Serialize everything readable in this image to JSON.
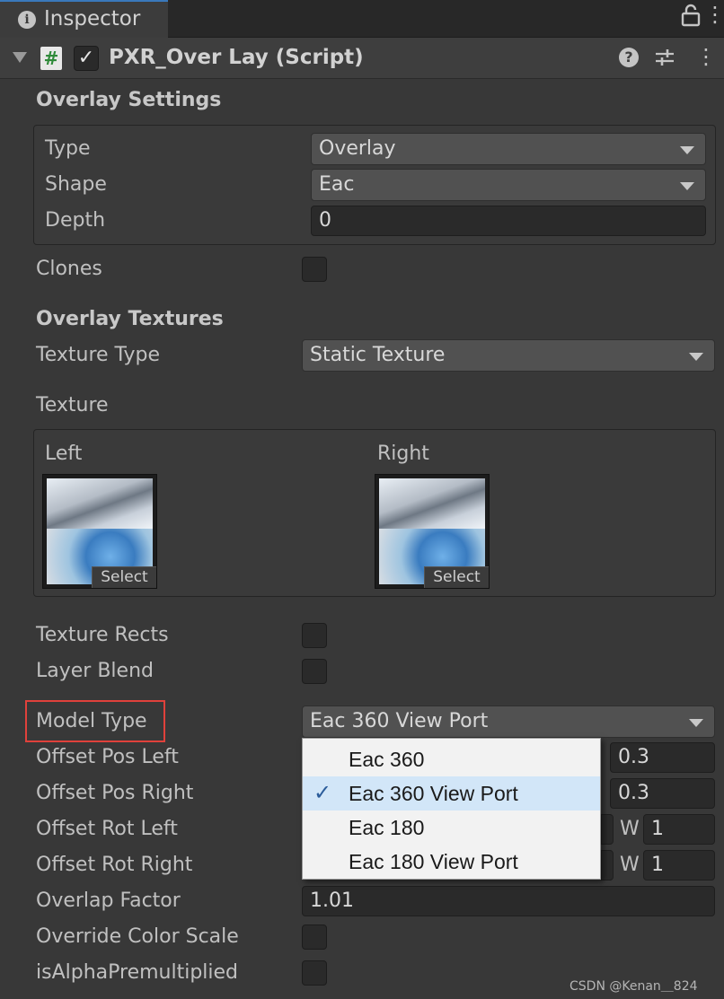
{
  "tab": {
    "title": "Inspector"
  },
  "component": {
    "title": "PXR_Over Lay (Script)",
    "script_glyph": "#",
    "enabled": true
  },
  "overlay_settings": {
    "heading": "Overlay Settings",
    "type_label": "Type",
    "type_value": "Overlay",
    "shape_label": "Shape",
    "shape_value": "Eac",
    "depth_label": "Depth",
    "depth_value": "0"
  },
  "clones_label": "Clones",
  "overlay_textures": {
    "heading": "Overlay Textures",
    "texture_type_label": "Texture Type",
    "texture_type_value": "Static Texture",
    "texture_label": "Texture",
    "left_label": "Left",
    "right_label": "Right",
    "select_label": "Select"
  },
  "texture_rects_label": "Texture Rects",
  "layer_blend_label": "Layer Blend",
  "model_type": {
    "label": "Model Type",
    "value": "Eac 360 View Port"
  },
  "popup": {
    "options": [
      "Eac 360",
      "Eac 360 View Port",
      "Eac 180",
      "Eac 180 View Port"
    ],
    "selected": "Eac 360 View Port"
  },
  "offset_pos_left": {
    "label": "Offset Pos Left",
    "value": "0.3"
  },
  "offset_pos_right": {
    "label": "Offset Pos Right",
    "value": "0.3"
  },
  "offset_rot_left": {
    "label": "Offset Rot Left",
    "w_label": "W",
    "w_value": "1"
  },
  "offset_rot_right": {
    "label": "Offset Rot Right",
    "w_label": "W",
    "w_value": "1"
  },
  "overlap_factor": {
    "label": "Overlap Factor",
    "value": "1.01"
  },
  "override_color_scale_label": "Override Color Scale",
  "is_alpha_premultiplied_label": "isAlphaPremultiplied",
  "watermark": "CSDN @Kenan＿824",
  "colors": {
    "accent_highlight": "#e0413b",
    "tab_accent": "#3a79bb",
    "popup_selected": "#d2e6f8"
  }
}
